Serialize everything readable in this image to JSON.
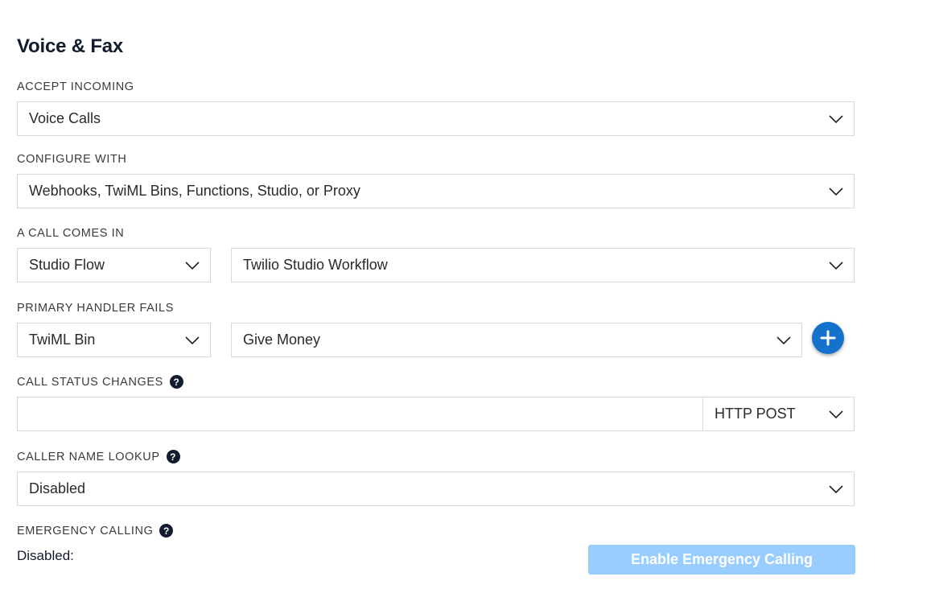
{
  "section": {
    "title": "Voice & Fax"
  },
  "accept_incoming": {
    "label": "ACCEPT INCOMING",
    "value": "Voice Calls"
  },
  "configure_with": {
    "label": "CONFIGURE WITH",
    "value": "Webhooks, TwiML Bins, Functions, Studio, or Proxy"
  },
  "call_comes_in": {
    "label": "A CALL COMES IN",
    "type_value": "Studio Flow",
    "target_value": "Twilio Studio Workflow"
  },
  "primary_handler_fails": {
    "label": "PRIMARY HANDLER FAILS",
    "type_value": "TwiML Bin",
    "target_value": "Give Money"
  },
  "call_status_changes": {
    "label": "CALL STATUS CHANGES",
    "url_value": "",
    "method_value": "HTTP POST"
  },
  "caller_name_lookup": {
    "label": "CALLER NAME LOOKUP",
    "value": "Disabled"
  },
  "emergency_calling": {
    "label": "EMERGENCY CALLING",
    "status_text": "Disabled:",
    "button_label": "Enable Emergency Calling"
  },
  "icons": {
    "help": "question-circle-icon",
    "dropdown": "chevron-down-icon",
    "add": "plus-icon"
  },
  "colors": {
    "accent": "#1472cc",
    "disabled_button": "#99cdff",
    "heading": "#121c2d"
  }
}
